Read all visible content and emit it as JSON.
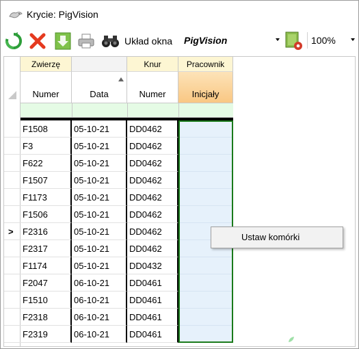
{
  "window": {
    "title": "Krycie: PigVision"
  },
  "toolbar": {
    "layout_label": "Układ okna",
    "layout_value": "PigVision",
    "zoom_value": "100%",
    "icons": [
      "refresh-icon",
      "delete-icon",
      "download-icon",
      "print-icon",
      "binoculars-icon",
      "layout-settings-icon"
    ]
  },
  "grid": {
    "bands": [
      {
        "label": "Zwierzę"
      },
      {
        "label": ""
      },
      {
        "label": "Knur"
      },
      {
        "label": "Pracownik"
      }
    ],
    "columns": [
      {
        "label": "Numer"
      },
      {
        "label": "Data"
      },
      {
        "label": "Numer"
      },
      {
        "label": "Inicjały"
      }
    ],
    "rows": [
      [
        "F1508",
        "05-10-21",
        "DD0462",
        ""
      ],
      [
        "F3",
        "05-10-21",
        "DD0462",
        ""
      ],
      [
        "F622",
        "05-10-21",
        "DD0462",
        ""
      ],
      [
        "F1507",
        "05-10-21",
        "DD0462",
        ""
      ],
      [
        "F1173",
        "05-10-21",
        "DD0462",
        ""
      ],
      [
        "F1506",
        "05-10-21",
        "DD0462",
        ""
      ],
      [
        "F2316",
        "05-10-21",
        "DD0462",
        ""
      ],
      [
        "F2317",
        "05-10-21",
        "DD0462",
        ""
      ],
      [
        "F1174",
        "05-10-21",
        "DD0432",
        ""
      ],
      [
        "F2047",
        "06-10-21",
        "DD0461",
        ""
      ],
      [
        "F1510",
        "06-10-21",
        "DD0461",
        ""
      ],
      [
        "F2318",
        "06-10-21",
        "DD0461",
        ""
      ],
      [
        "F2319",
        "06-10-21",
        "DD0461",
        ""
      ]
    ],
    "current_row_index": 6,
    "current_row_marker": ">"
  },
  "context_menu": {
    "item": "Ustaw komórki"
  }
}
